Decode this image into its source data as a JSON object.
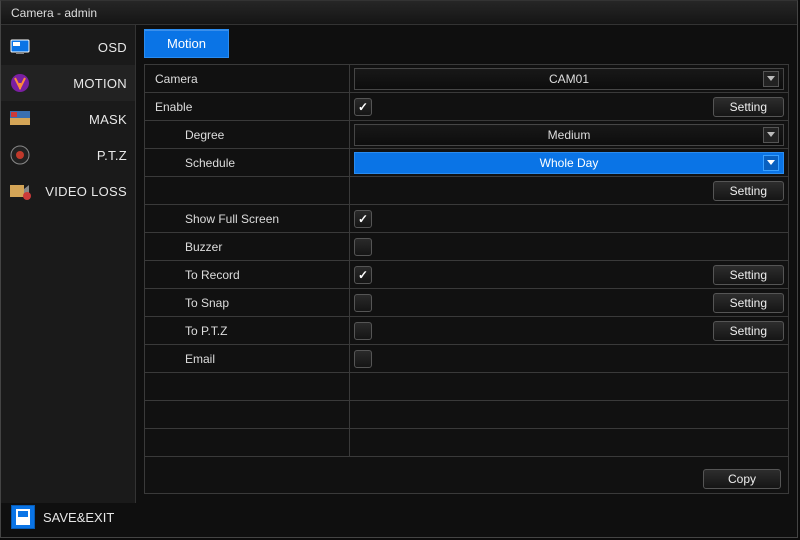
{
  "window": {
    "title": "Camera - admin"
  },
  "sidebar": {
    "items": [
      {
        "label": "OSD"
      },
      {
        "label": "MOTION"
      },
      {
        "label": "MASK"
      },
      {
        "label": "P.T.Z"
      },
      {
        "label": "VIDEO LOSS"
      }
    ]
  },
  "tabs": {
    "active": "Motion"
  },
  "fields": {
    "camera": {
      "label": "Camera",
      "value": "CAM01"
    },
    "enable": {
      "label": "Enable",
      "checked": true,
      "button": "Setting"
    },
    "degree": {
      "label": "Degree",
      "value": "Medium"
    },
    "schedule": {
      "label": "Schedule",
      "value": "Whole Day",
      "button": "Setting"
    },
    "showFullScreen": {
      "label": "Show Full Screen",
      "checked": true
    },
    "buzzer": {
      "label": "Buzzer",
      "checked": false
    },
    "toRecord": {
      "label": "To Record",
      "checked": true,
      "button": "Setting"
    },
    "toSnap": {
      "label": "To Snap",
      "checked": false,
      "button": "Setting"
    },
    "toPtz": {
      "label": "To P.T.Z",
      "checked": false,
      "button": "Setting"
    },
    "email": {
      "label": "Email",
      "checked": false
    }
  },
  "footer": {
    "saveExit": "SAVE&EXIT",
    "copy": "Copy"
  }
}
